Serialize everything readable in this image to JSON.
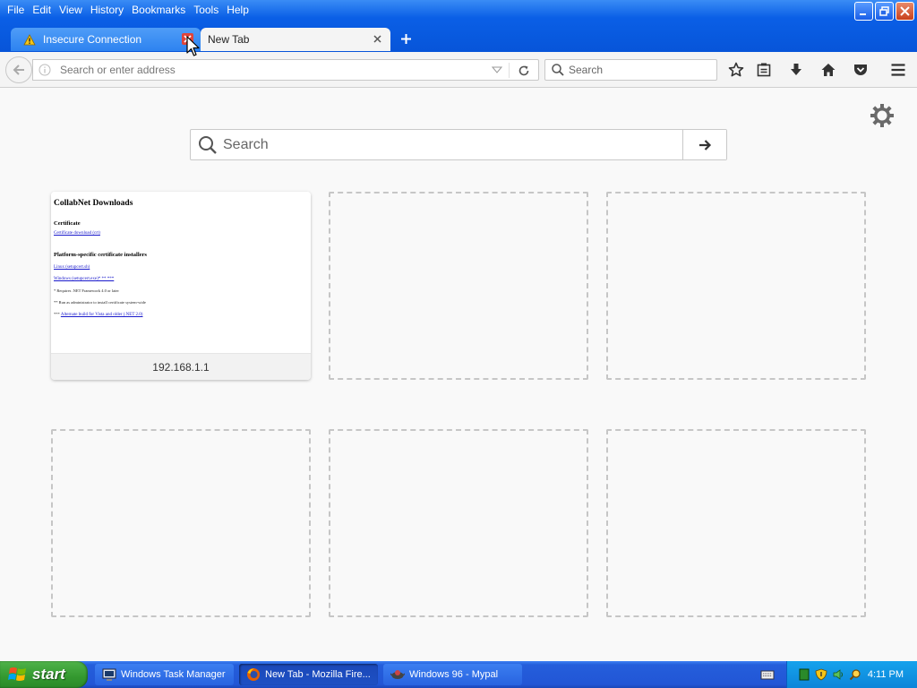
{
  "menu": {
    "items": [
      {
        "label": "File"
      },
      {
        "label": "Edit"
      },
      {
        "label": "View"
      },
      {
        "label": "History"
      },
      {
        "label": "Bookmarks"
      },
      {
        "label": "Tools"
      },
      {
        "label": "Help"
      }
    ]
  },
  "tabs": [
    {
      "label": "Insecure Connection",
      "active": false,
      "warning": true
    },
    {
      "label": "New Tab",
      "active": true
    }
  ],
  "navbar": {
    "url_placeholder": "Search or enter address",
    "search_placeholder": "Search"
  },
  "newtab": {
    "search_placeholder": "Search",
    "tiles": [
      {
        "title": "192.168.1.1",
        "thumbnail": {
          "heading": "CollabNet Downloads",
          "section1": "Certificate",
          "link1": "Certificate download (crt)",
          "section2": "Platform-specific certificate installers",
          "link2": "Linux (setupcert.sh)",
          "link3": "Windows (setupcert.exe)* ** ***",
          "note1": "* Requires .NET Framework 4.0 or later",
          "note2": "** Run as administrator to install certificate system-wide",
          "note3_prefix": "***",
          "note3_link": "Alternate build for Vista and older (.NET 2.0)"
        }
      }
    ]
  },
  "taskbar": {
    "start_label": "start",
    "tasks": [
      {
        "label": "Windows Task Manager",
        "active": false
      },
      {
        "label": "New Tab - Mozilla Fire...",
        "active": true
      },
      {
        "label": "Windows 96 - Mypal",
        "active": false
      }
    ],
    "clock": "4:11 PM"
  },
  "colors": {
    "xp_blue": "#0754d8",
    "start_green": "#33982f",
    "tray_blue": "#0c85d9",
    "page_bg": "#f9f9f9"
  }
}
